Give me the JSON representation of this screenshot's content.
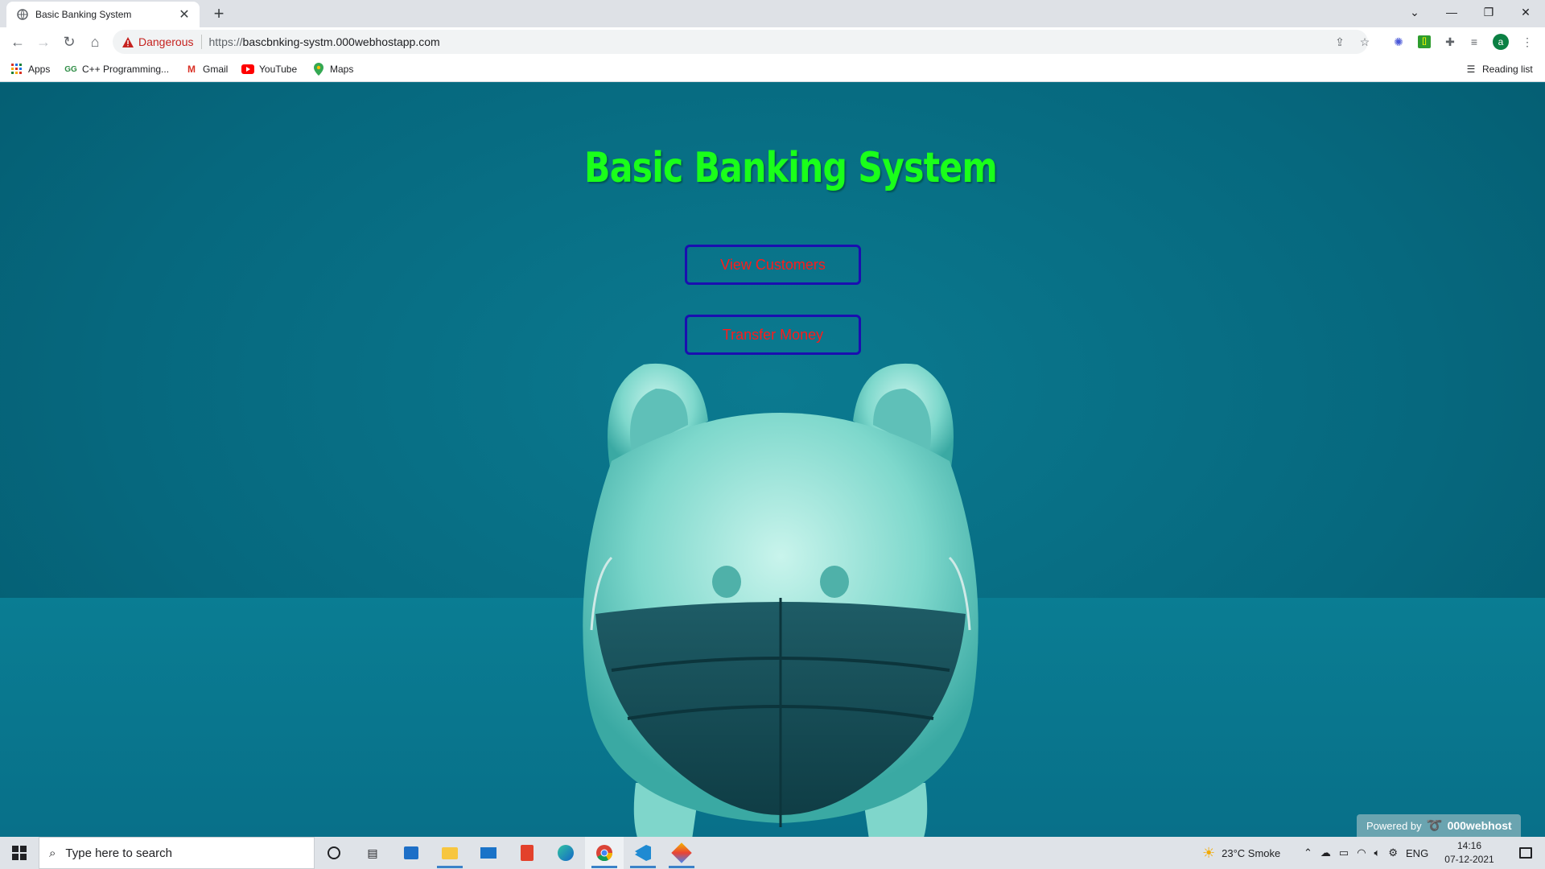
{
  "browser": {
    "tab_title": "Basic Banking System",
    "security_label": "Dangerous",
    "url_scheme": "https://",
    "url_host": "bascbnking-systm.000webhostapp.com",
    "profile_letter": "a",
    "bookmarks": [
      "Apps",
      "C++ Programming...",
      "Gmail",
      "YouTube",
      "Maps"
    ],
    "reading_list": "Reading list"
  },
  "page": {
    "title": "Basic Banking System",
    "buttons": {
      "view_customers": "View Customers",
      "transfer_money": "Transfer Money"
    },
    "powered_by": "Powered by",
    "host_brand": "000webhost"
  },
  "taskbar": {
    "search_placeholder": "Type here to search",
    "weather": "23°C  Smoke",
    "language": "ENG",
    "time": "14:16",
    "date": "07-12-2021"
  },
  "colors": {
    "page_bg": "#0a6f85",
    "title_green": "#1aff1a",
    "button_text": "#ff1a1a",
    "button_border": "#1a0fb0",
    "danger": "#c5221f"
  }
}
